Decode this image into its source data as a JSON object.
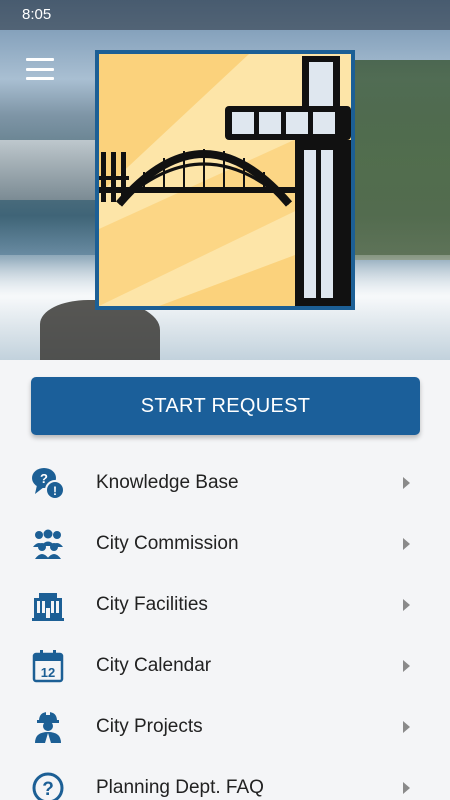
{
  "status_bar": {
    "time": "8:05"
  },
  "header": {
    "menu_icon": "hamburger-menu-icon",
    "logo": "bridge-and-elevator-logo"
  },
  "primary_action": {
    "label": "START REQUEST",
    "color": "#1b5f9a"
  },
  "menu": {
    "items": [
      {
        "label": "Knowledge Base",
        "icon": "question-chat-icon"
      },
      {
        "label": "City Commission",
        "icon": "people-group-icon"
      },
      {
        "label": "City Facilities",
        "icon": "building-icon"
      },
      {
        "label": "City Calendar",
        "icon": "calendar-icon"
      },
      {
        "label": "City Projects",
        "icon": "hardhat-worker-icon"
      },
      {
        "label": "Planning Dept. FAQ",
        "icon": "question-circle-icon"
      }
    ]
  },
  "colors": {
    "accent": "#1b5f9a",
    "icon": "#1c5f95",
    "text": "#222222",
    "background": "#f4f5f7"
  }
}
